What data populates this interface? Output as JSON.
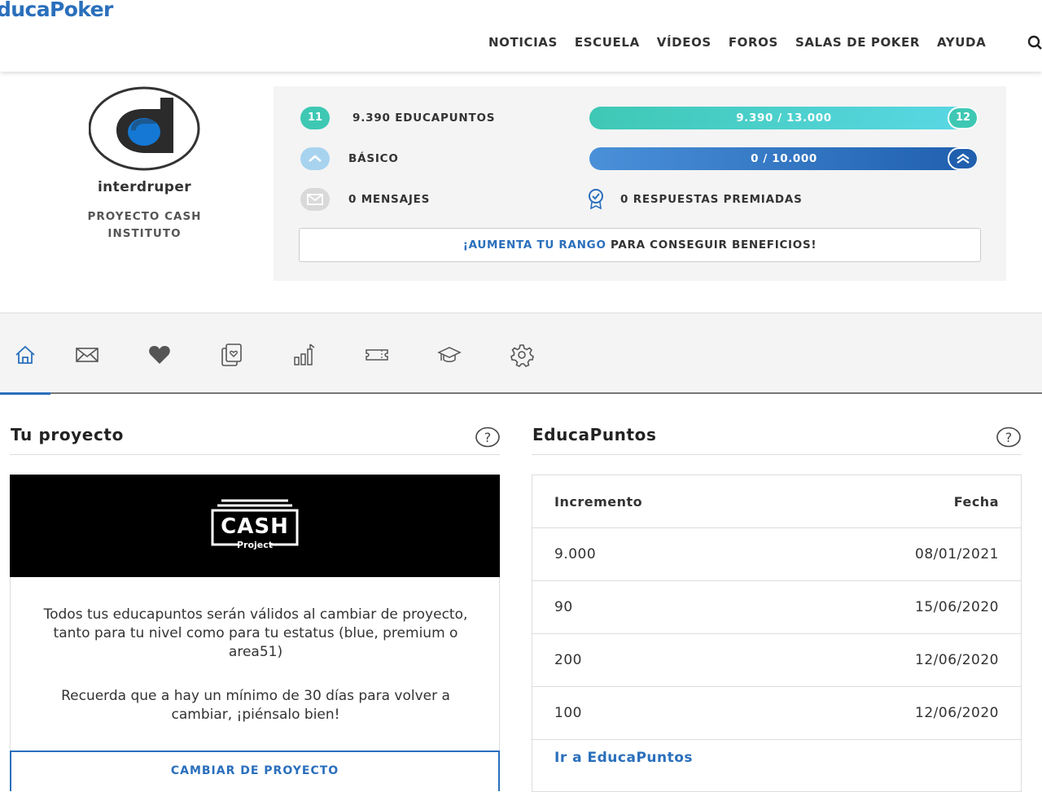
{
  "header": {
    "logo": "ducaPoker",
    "nav": [
      "NOTICIAS",
      "ESCUELA",
      "VÍDEOS",
      "FOROS",
      "SALAS DE POKER",
      "AYUDA"
    ],
    "search_icon": "search-icon"
  },
  "profile": {
    "username": "interdruper",
    "project_line1": "PROYECTO CASH",
    "project_line2": "INSTITUTO"
  },
  "stats": {
    "level_current": "11",
    "educapuntos_label": "9.390 EDUCAPUNTOS",
    "level_next": "12",
    "level_progress_text": "9.390 / 13.000",
    "level_progress_fraction": 0.722,
    "rank_label": "BÁSICO",
    "rank_progress_text": "0 / 10.000",
    "rank_progress_fraction": 0.0,
    "messages_label": "0 MENSAJES",
    "awarded_label": "0 RESPUESTAS PREMIADAS",
    "cta_link": "¡AUMENTA TU RANGO",
    "cta_rest": " PARA CONSEGUIR BENEFICIOS!",
    "colors": {
      "teal": "#3ec8b4",
      "cyan": "#5ad8e6",
      "blue_dark": "#1f5fae",
      "blue_light": "#4a90d9",
      "accent": "#2a6fbc"
    }
  },
  "tabs": {
    "icons": [
      "home-icon",
      "mail-icon",
      "heart-icon",
      "cards-icon",
      "chart-icon",
      "ticket-icon",
      "graduation-cap-icon",
      "gear-icon"
    ],
    "active": "home-icon"
  },
  "project": {
    "title": "Tu proyecto",
    "badge_main": "CASH",
    "badge_sub": "Project",
    "para1": "Todos tus educapuntos serán válidos al cambiar de proyecto, tanto para tu nivel como para tu estatus (blue, premium o area51)",
    "para2": "Recuerda que a hay un mínimo de 30 días para volver a cambiar, ¡piénsalo bien!",
    "button": "CAMBIAR DE PROYECTO"
  },
  "educapuntos": {
    "title": "EducaPuntos",
    "col_increment": "Incremento",
    "col_date": "Fecha",
    "rows": [
      {
        "amount": "9.000",
        "date": "08/01/2021"
      },
      {
        "amount": "90",
        "date": "15/06/2020"
      },
      {
        "amount": "200",
        "date": "12/06/2020"
      },
      {
        "amount": "100",
        "date": "12/06/2020"
      }
    ],
    "link": "Ir a EducaPuntos"
  }
}
